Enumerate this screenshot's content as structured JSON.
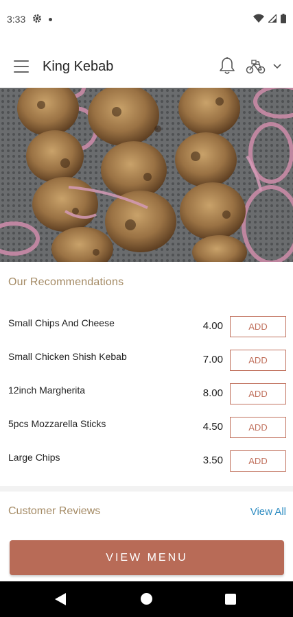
{
  "status_bar": {
    "time": "3:33",
    "icons": [
      "gear-icon",
      "notification-dot",
      "wifi-icon",
      "signal-icon",
      "battery-icon"
    ]
  },
  "app_bar": {
    "title": "King Kebab",
    "icons": [
      "menu-icon",
      "bell-icon",
      "bike-icon",
      "chevron-down-icon"
    ]
  },
  "hero": {
    "subject": "kebab skewers photo"
  },
  "recommendations": {
    "title": "Our Recommendations",
    "items": [
      {
        "name": "Small Chips And Cheese",
        "price": "4.00",
        "button": "ADD"
      },
      {
        "name": "Small Chicken Shish Kebab",
        "price": "7.00",
        "button": "ADD"
      },
      {
        "name": "12inch Margherita",
        "price": "8.00",
        "button": "ADD"
      },
      {
        "name": "5pcs Mozzarella Sticks",
        "price": "4.50",
        "button": "ADD"
      },
      {
        "name": "Large Chips",
        "price": "3.50",
        "button": "ADD"
      }
    ]
  },
  "reviews": {
    "title": "Customer Reviews",
    "view_all": "View All"
  },
  "cta": {
    "label": "VIEW MENU"
  },
  "nav_bar": {
    "icons": [
      "back-icon",
      "home-icon",
      "recents-icon"
    ]
  },
  "colors": {
    "accent": "#b86b57",
    "section_heading": "#a48a64",
    "link": "#2f8dc2"
  }
}
